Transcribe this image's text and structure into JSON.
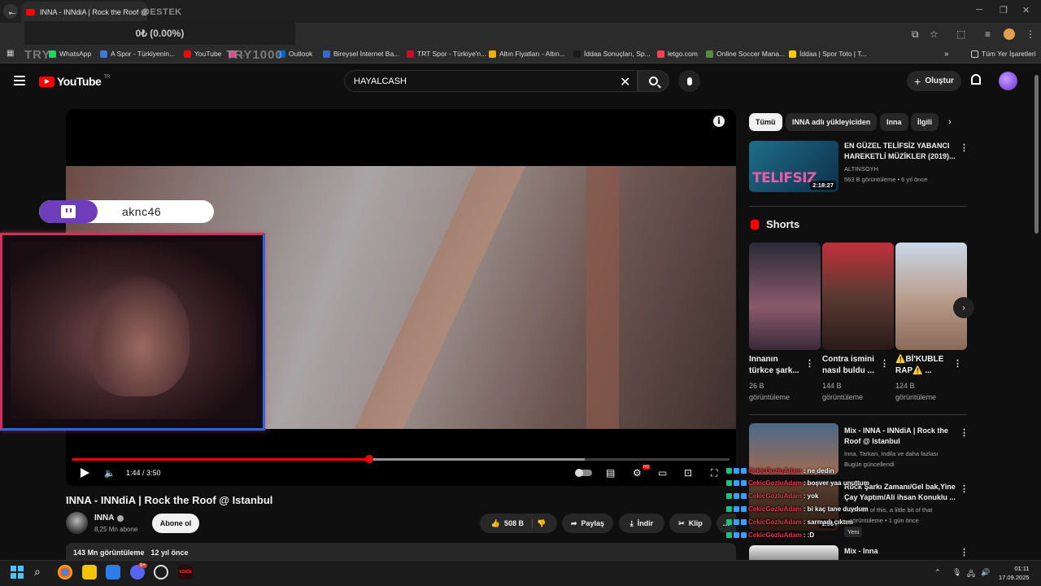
{
  "browser": {
    "active_tab_title": "INNA - INNdiA | Rock the Roof @ Istanbul - YouTube",
    "bookmarks": [
      {
        "label": "WhatsApp",
        "color": "#25d366"
      },
      {
        "label": "A Spor - Türkiyenin...",
        "color": "#3a7bd5"
      },
      {
        "label": "YouTube",
        "color": "#ff0000"
      },
      {
        "label": "...",
        "color": "#e04a8a"
      },
      {
        "label": "Outlook",
        "color": "#0a64c8"
      },
      {
        "label": "Bireysel İnternet Ba...",
        "color": "#3a6ac8"
      },
      {
        "label": "TRT Spor - Türkiye'n...",
        "color": "#c8102e"
      },
      {
        "label": "Altın Fiyatları - Altın...",
        "color": "#f0b400"
      },
      {
        "label": "İddaa Sonuçları, Sp...",
        "color": "#1a1a1a"
      },
      {
        "label": "letgo.com",
        "color": "#ff3f55"
      },
      {
        "label": "Online Soccer Mana...",
        "color": "#5a8a3a"
      },
      {
        "label": "İddaa | Spor Toto | T...",
        "color": "#ffcc00"
      }
    ],
    "all_bookmarks_label": "Tüm Yer İşaretleri",
    "more_bookmarks": "»"
  },
  "stream_overlays": {
    "destek_label": "DESTEK",
    "donation_text": "0₺ (0.00%)",
    "try_text_1": "TRY",
    "try_text_2": "TRY1000",
    "twitch_username": "aknc46"
  },
  "youtube": {
    "logo_text": "YouTube",
    "country_code": "TR",
    "search_value": "HAYALCASH",
    "create_label": "Oluştur",
    "player": {
      "current_time": "1:44",
      "duration": "3:50",
      "time_display": "1:44 / 3:50",
      "progress_fraction": 0.452,
      "buffer_fraction": 0.78,
      "settings_badge": "HD"
    },
    "video": {
      "title": "INNA - INNdiA | Rock the Roof @ Istanbul",
      "channel": "INNA",
      "subscribers": "8,25 Mn abone",
      "subscribe_label": "Abone ol",
      "likes": "508 B",
      "share_label": "Paylaş",
      "download_label": "İndir",
      "clip_label": "Klip",
      "views": "143 Mn görüntüleme",
      "age": "12 yıl önce"
    },
    "chips": [
      "Tümü",
      "INNA adlı yükleyiciden",
      "Inna",
      "İlgili"
    ],
    "recommendations": [
      {
        "title_line1": "EN GÜZEL TELİFSİZ YABANCI",
        "title_line2": "HAREKETLİ MÜZİKLER (2019)...",
        "channel": "ALTINSOYH",
        "meta": "563 B görüntüleme • 6 yıl önce",
        "duration": "2:18:27",
        "thumb_text": "TELIFSIZ"
      }
    ],
    "shorts_heading": "Shorts",
    "shorts": [
      {
        "title_line1": "Innanın",
        "title_line2": "türkce şark...",
        "views_line1": "26 B",
        "views_line2": "görüntüleme"
      },
      {
        "title_line1": "Contra ismini",
        "title_line2": "nasıl buldu ...",
        "views_line1": "144 B",
        "views_line2": "görüntüleme"
      },
      {
        "title_line1": "⚠️Bİ'KUBLE",
        "title_line2": "RAP⚠️ ...",
        "views_line1": "124 B",
        "views_line2": "görüntüleme"
      }
    ],
    "mixes": [
      {
        "title_line1": "Mix - INNA - INNdiA | Rock the",
        "title_line2": "Roof @ Istanbul",
        "meta_line1": "Inna, Tarkan, Indila ve daha fazlası",
        "meta_line2": "Bugün güncellendi"
      },
      {
        "title_line1": "Rock Şarkı Zamanı/Gel bak,Yine",
        "title_line2": "Çay Yaptım/Ali ihsan Konuklu ...",
        "meta_line1": "...little bit of this, a little bit of that",
        "meta_line2": "...görüntüleme • 1 gün önce",
        "duration": "1:56",
        "badge": "Yeni"
      },
      {
        "title_line1": "Mix - Inna"
      }
    ]
  },
  "chat": [
    {
      "user": "CekicGozluAdam",
      "message": ": ne dedin"
    },
    {
      "user": "CekicGozluAdam",
      "message": ": boşver yaa unuttum"
    },
    {
      "user": "CekicGozluAdam",
      "message": ": yok"
    },
    {
      "user": "CekicGozluAdam",
      "message": ": bi kaç tane duydum"
    },
    {
      "user": "CekicGozluAdam",
      "message": ": sarmadı çıktım"
    },
    {
      "user": "CekicGozluAdam",
      "message": ": :D"
    }
  ],
  "taskbar": {
    "time": "01:11",
    "date": "17.09.2025",
    "discord_badge": "9+",
    "app_label": "VOICE"
  }
}
